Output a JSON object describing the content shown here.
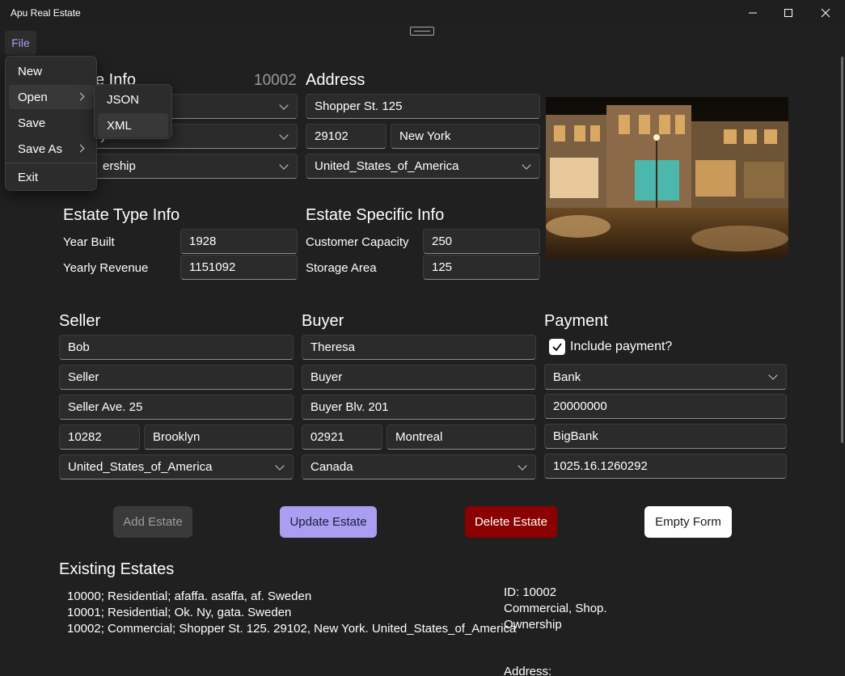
{
  "window": {
    "title": "Apu Real Estate"
  },
  "menu": {
    "file": "File",
    "items": [
      "New",
      "Open",
      "Save",
      "Save As",
      "Exit"
    ],
    "open_submenu": [
      "JSON",
      "XML"
    ]
  },
  "estate": {
    "section_partial": "e Info",
    "id": "10002",
    "type_partial": "y",
    "legal_partial": "ership"
  },
  "address": {
    "heading": "Address",
    "street": "Shopper St. 125",
    "zip": "29102",
    "city": "New York",
    "country": "United_States_of_America"
  },
  "type_info": {
    "heading": "Estate Type Info",
    "year_label": "Year Built",
    "year_value": "1928",
    "revenue_label": "Yearly Revenue",
    "revenue_value": "1151092"
  },
  "specific_info": {
    "heading": "Estate Specific Info",
    "capacity_label": "Customer Capacity",
    "capacity_value": "250",
    "storage_label": "Storage Area",
    "storage_value": "125"
  },
  "seller": {
    "heading": "Seller",
    "name": "Bob",
    "role": "Seller",
    "street": "Seller Ave. 25",
    "zip": "10282",
    "city": "Brooklyn",
    "country": "United_States_of_America"
  },
  "buyer": {
    "heading": "Buyer",
    "name": "Theresa",
    "role": "Buyer",
    "street": "Buyer Blv. 201",
    "zip": "02921",
    "city": "Montreal",
    "country": "Canada"
  },
  "payment": {
    "heading": "Payment",
    "include_label": "Include payment?",
    "method": "Bank",
    "amount": "20000000",
    "bank": "BigBank",
    "account": "1025.16.1260292"
  },
  "buttons": {
    "add": "Add Estate",
    "update": "Update Estate",
    "delete": "Delete Estate",
    "empty": "Empty Form"
  },
  "existing": {
    "heading": "Existing Estates",
    "rows": [
      "10000; Residential; afaffa. asaffa, af. Sweden",
      "10001; Residential; Ok. Ny, gata. Sweden",
      "10002; Commercial; Shopper St. 125. 29102, New York. United_States_of_America"
    ]
  },
  "details": {
    "id_line": "ID: 10002",
    "type_line": "Commercial, Shop.",
    "legal_line": "Ownership",
    "address_label": "Address:"
  },
  "colors": {
    "background": "#202020",
    "accent": "#a99ef0",
    "delete": "#8b0000",
    "update": "#a99ef0"
  }
}
